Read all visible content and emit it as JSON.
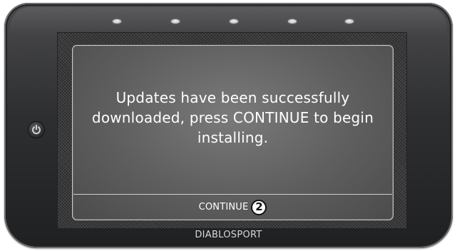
{
  "device": {
    "brand": "DIABLOSPORT",
    "led_count": 5,
    "colors": {
      "body": "#2e2f31",
      "screen_panel": "#5e5e5e",
      "text": "#ffffff",
      "badge": "#ffffff"
    }
  },
  "screen": {
    "message": "Updates have been successfully downloaded, press CONTINUE to begin installing.",
    "continue_label": "CONTINUE",
    "step_marker": "2"
  },
  "icons": {
    "power": "power-icon",
    "status_lights": "led-indicator-icon"
  }
}
